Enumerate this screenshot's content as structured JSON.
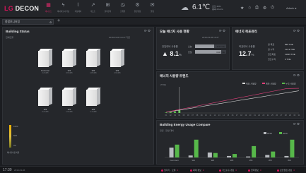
{
  "app": {
    "logo_lg": "LG",
    "logo_name": "DECON"
  },
  "nav": [
    {
      "icon": "▦",
      "label": "대시보드",
      "active": true
    },
    {
      "icon": "ϟ",
      "label": "에너지모니터링"
    },
    {
      "icon": "⌇",
      "label": "자동제어"
    },
    {
      "icon": "↗",
      "label": "리포트"
    },
    {
      "icon": "⊞",
      "label": "설비관리"
    },
    {
      "icon": "◷",
      "label": "스케줄"
    },
    {
      "icon": "⚙",
      "label": "환경설정"
    },
    {
      "icon": "✉",
      "label": "알림"
    }
  ],
  "weather": {
    "temp": "6.1℃",
    "line1": "습도 45%",
    "line2": "풍속 2.1m/s"
  },
  "tools": [
    "★",
    "⌂",
    "⎙",
    "⚙",
    "⏻"
  ],
  "user": "Admin ▾",
  "secbar": {
    "dashboard_name": "종합모니터링",
    "gear": "⚙",
    "add": "+"
  },
  "building_status": {
    "title": "Building Status",
    "date": "2019-03-06 10:27 기준",
    "sub": "전체건물",
    "icons": "⟳ ⚙",
    "buildings": [
      {
        "name": "Common",
        "value": "2.2 kWh"
      },
      {
        "name": "W1",
        "value": "3.6 kWh"
      },
      {
        "name": "W2",
        "value": "1.8 kWh"
      },
      {
        "name": "W3",
        "value": "2.9 kWh"
      },
      {
        "name": "W4",
        "value": "3.2 kWh"
      },
      {
        "name": "W5",
        "value": "1.9 kWh"
      },
      {
        "name": "W6",
        "value": "1.1 kWh"
      }
    ],
    "legend": [
      "100%",
      "50%",
      "0%"
    ],
    "legend_caption": "에너지사용 비율"
  },
  "today_usage": {
    "title": "오늘 에너지 사용 현황",
    "date": "2019-03-06 10:27",
    "icons": "⟳ ⚙",
    "kpi_label": "전일대비 사용률",
    "kpi_value": "8.1",
    "kpi_unit": "%",
    "bars": [
      {
        "label": "오늘",
        "value": "114 TOE",
        "fill": 0.62
      },
      {
        "label": "전일",
        "value": "154 TOE",
        "fill": 0.84
      }
    ]
  },
  "target": {
    "title": "에너지 목표관리",
    "icons": "⟳ ⚙",
    "kpi_label": "목표대비 사용률",
    "kpi_value": "12.7",
    "kpi_unit": "%",
    "rows": [
      {
        "label": "월 목표",
        "value": "895 TOE"
      },
      {
        "label": "월 누적",
        "value": "113.9 TOE"
      },
      {
        "label": "연간목표",
        "value": "11196 TOE"
      },
      {
        "label": "연간누적",
        "value": "0 TOE"
      }
    ]
  },
  "trend": {
    "title": "에너지 사용량 트렌드",
    "icons": "⟳ ⚙",
    "unit": "(TOE)",
    "legend": [
      "목표 사용량",
      "예측 사용량",
      "누적 사용량"
    ],
    "colors": {
      "target": "#d8d8d8",
      "forecast": "#e0407a",
      "actual": "#57b84a"
    }
  },
  "compare": {
    "title": "Building Energy Usage Compare",
    "icons": "⟳ ⚙",
    "sub": "전년 · 전월 대비",
    "legend": [
      "2018",
      "2019"
    ],
    "colors": {
      "prev": "#b8bbc0",
      "curr": "#57b84a"
    }
  },
  "chart_data": [
    {
      "type": "line",
      "title": "에너지 사용량 트렌드",
      "ylabel": "(TOE)",
      "x": [
        "01",
        "02",
        "03",
        "04",
        "05",
        "06",
        "07",
        "08",
        "09",
        "10",
        "11",
        "12",
        "13",
        "14",
        "15",
        "16",
        "17",
        "18",
        "19",
        "20",
        "21",
        "22",
        "23",
        "24",
        "25",
        "26",
        "27",
        "28",
        "29",
        "30",
        "31"
      ],
      "ylim": [
        0,
        1000
      ],
      "series": [
        {
          "name": "목표 사용량",
          "values": [
            29,
            58,
            87,
            116,
            145,
            174,
            203,
            232,
            261,
            290,
            319,
            348,
            377,
            406,
            435,
            464,
            493,
            522,
            551,
            580,
            609,
            638,
            667,
            696,
            725,
            754,
            783,
            812,
            841,
            870,
            899
          ]
        },
        {
          "name": "예측 사용량",
          "values": [
            35,
            70,
            105,
            140,
            175,
            210,
            245,
            280,
            315,
            350,
            385,
            420,
            455,
            490,
            525,
            560,
            595,
            630,
            665,
            700,
            735,
            770,
            805,
            840,
            875,
            910,
            945,
            980,
            990,
            995,
            999
          ]
        }
      ],
      "bars": {
        "name": "누적 사용량",
        "values": [
          20,
          40,
          60,
          114,
          0,
          0,
          0,
          0,
          0,
          0,
          0,
          0,
          0,
          0,
          0,
          0,
          0,
          0,
          0,
          0,
          0,
          0,
          0,
          0,
          0,
          0,
          0,
          0,
          0,
          0,
          0
        ]
      }
    },
    {
      "type": "bar",
      "title": "Building Energy Usage Compare",
      "categories": [
        "Common",
        "W1",
        "W2",
        "W3",
        "W4",
        "W5",
        "W6"
      ],
      "series": [
        {
          "name": "2018",
          "values": [
            2.0,
            0.4,
            1.0,
            0.3,
            0.2,
            0.5,
            0.3
          ]
        },
        {
          "name": "2019",
          "values": [
            2.6,
            3.6,
            0.9,
            0.7,
            2.3,
            1.2,
            3.6
          ]
        }
      ],
      "ylim": [
        0,
        4
      ]
    }
  ],
  "bottom": {
    "time": "17:30",
    "date": "2019-03-06",
    "alarms": [
      {
        "label": "냉각기 · 오류",
        "count": "0"
      },
      {
        "label": "화재 경보",
        "count": "0"
      },
      {
        "label": "가스누출 경보",
        "count": "0"
      },
      {
        "label": "전력경보",
        "count": "0"
      },
      {
        "label": "보안침입 경보",
        "count": "0"
      }
    ]
  }
}
